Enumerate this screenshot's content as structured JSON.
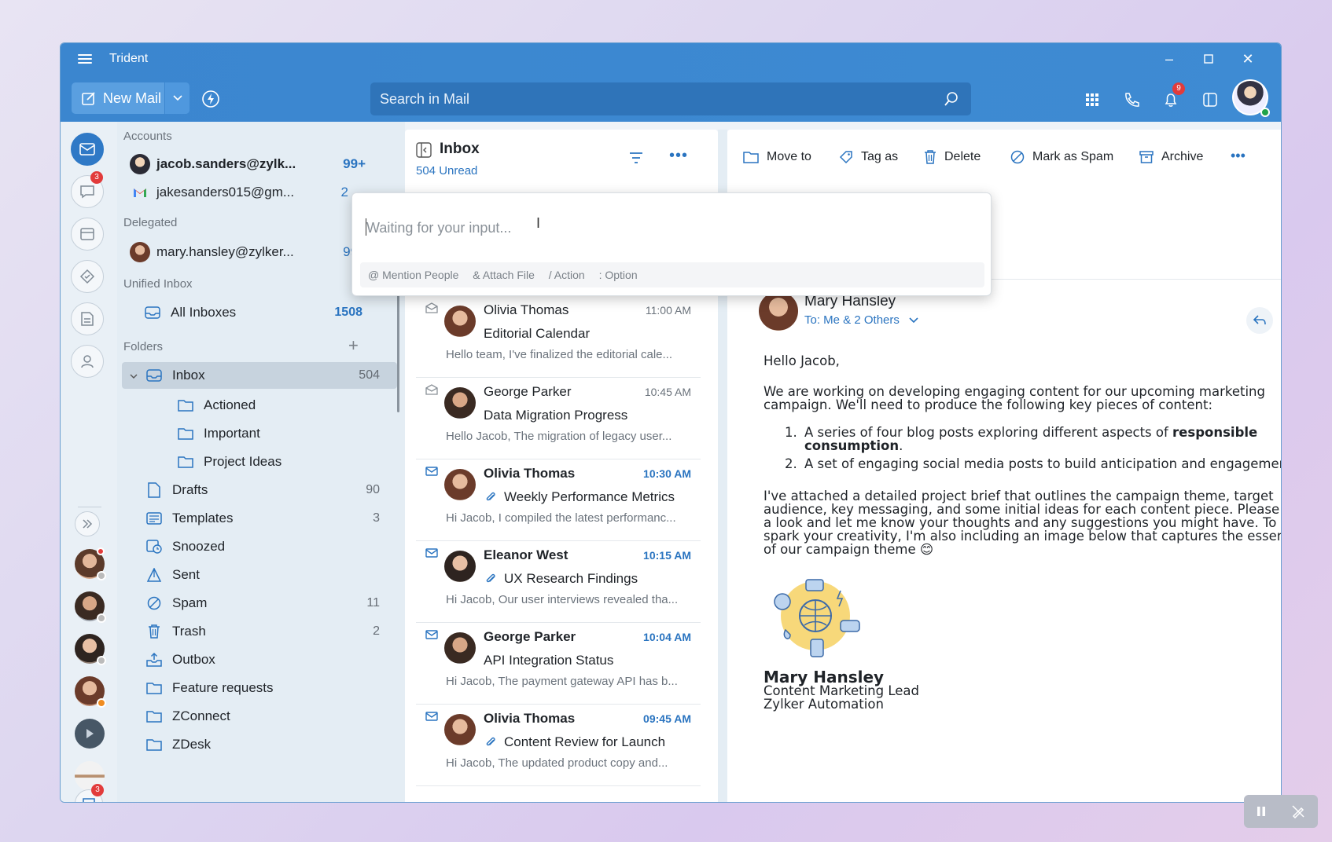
{
  "app": {
    "title": "Trident"
  },
  "toolbar": {
    "new_mail": "New Mail",
    "search_placeholder": "Search in Mail",
    "notification_count": "9"
  },
  "rail": {
    "chat_badge": "3",
    "bottom_badge": "3"
  },
  "sidebar": {
    "accounts_label": "Accounts",
    "accounts": [
      {
        "email": "jacob.sanders@zylk...",
        "count": "99+"
      },
      {
        "email": "jakesanders015@gm...",
        "count": "2"
      }
    ],
    "delegated_label": "Delegated",
    "delegated": [
      {
        "email": "mary.hansley@zylker...",
        "count": "99+"
      }
    ],
    "unified_label": "Unified Inbox",
    "all_inboxes": {
      "label": "All Inboxes",
      "count": "1508"
    },
    "folders_label": "Folders",
    "folders": [
      {
        "label": "Inbox",
        "count": "504"
      },
      {
        "label": "Actioned",
        "count": ""
      },
      {
        "label": "Important",
        "count": ""
      },
      {
        "label": "Project Ideas",
        "count": ""
      },
      {
        "label": "Drafts",
        "count": "90"
      },
      {
        "label": "Templates",
        "count": "3"
      },
      {
        "label": "Snoozed",
        "count": ""
      },
      {
        "label": "Sent",
        "count": ""
      },
      {
        "label": "Spam",
        "count": "11"
      },
      {
        "label": "Trash",
        "count": "2"
      },
      {
        "label": "Outbox",
        "count": ""
      },
      {
        "label": "Feature requests",
        "count": ""
      },
      {
        "label": "ZConnect",
        "count": ""
      },
      {
        "label": "ZDesk",
        "count": ""
      }
    ]
  },
  "list": {
    "title": "Inbox",
    "unread": "504 Unread",
    "items": [
      {
        "from": "Olivia Thomas",
        "time": "11:00 AM",
        "subject": "Editorial Calendar",
        "snippet": "Hello team, I've finalized the editorial cale..."
      },
      {
        "from": "George Parker",
        "time": "10:45 AM",
        "subject": "Data Migration Progress",
        "snippet": "Hello Jacob, The migration of legacy user..."
      },
      {
        "from": "Olivia Thomas",
        "time": "10:30 AM",
        "subject": "Weekly Performance Metrics",
        "snippet": "Hi Jacob, I compiled the latest performanc..."
      },
      {
        "from": "Eleanor West",
        "time": "10:15 AM",
        "subject": "UX Research Findings",
        "snippet": "Hi Jacob, Our user interviews revealed tha..."
      },
      {
        "from": "George Parker",
        "time": "10:04 AM",
        "subject": "API Integration Status",
        "snippet": "Hi Jacob, The payment gateway API has b..."
      },
      {
        "from": "Olivia Thomas",
        "time": "09:45 AM",
        "subject": "Content Review for Launch",
        "snippet": "Hi Jacob, The updated product copy and..."
      }
    ]
  },
  "reader": {
    "actions": {
      "move": "Move to",
      "tag": "Tag as",
      "delete": "Delete",
      "spam": "Mark as Spam",
      "archive": "Archive"
    },
    "sender": "Mary Hansley",
    "to": "To: Me & 2 Others",
    "greeting": "Hello Jacob,",
    "intro": "We are working on developing engaging content for our upcoming marketing campaign. We'll need to produce the following key pieces of content:",
    "item1_pre": "A series of four blog posts exploring different aspects of ",
    "item1_bold": "responsible consumption",
    "item1_post": ".",
    "item2": "A set of engaging social media posts to build anticipation and engagement.",
    "para": "I've attached a detailed project brief that outlines the campaign theme, target audience, key messaging, and some initial ideas for each content piece. Please take a look and let me know your thoughts and any suggestions you might have. To spark your creativity, I'm also including an image below that captures the essence of our campaign theme 😊",
    "sig_name": "Mary Hansley",
    "sig_title": "Content Marketing Lead",
    "sig_company": "Zylker Automation"
  },
  "popup": {
    "placeholder": "Waiting for your input...",
    "hints": [
      "@ Mention People",
      "& Attach File",
      "/ Action",
      ": Option"
    ]
  }
}
